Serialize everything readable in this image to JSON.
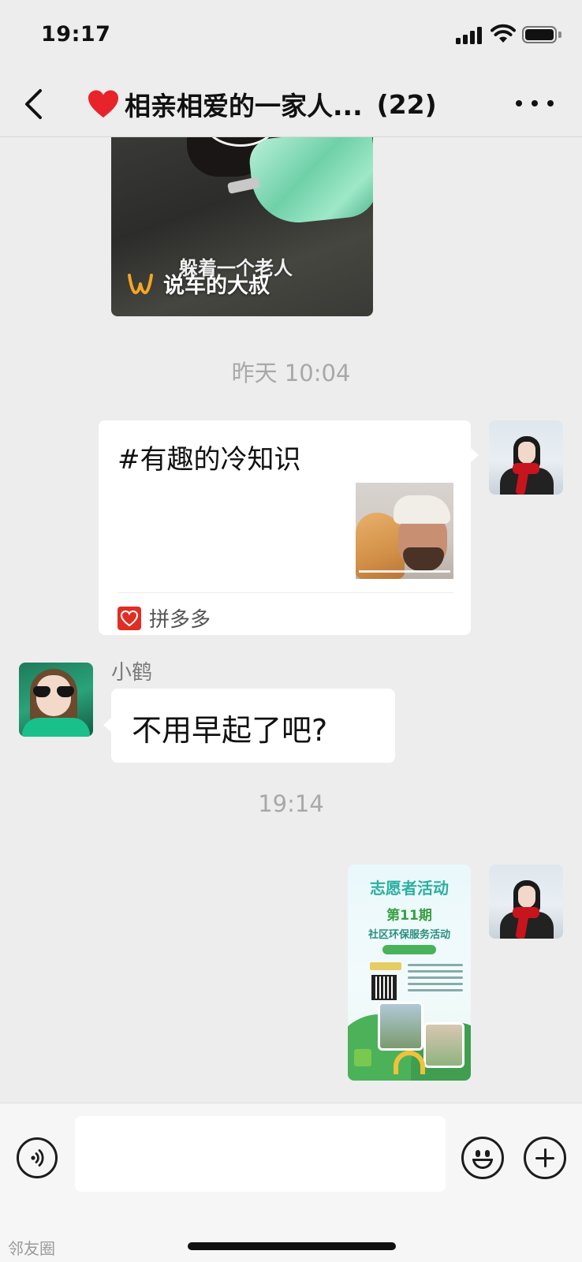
{
  "status_bar": {
    "time": "19:17",
    "icons": [
      "signal-icon",
      "wifi-icon",
      "battery-icon"
    ]
  },
  "nav": {
    "back_icon": "chevron-left-icon",
    "title_emoji": "red-heart-icon",
    "title": "相亲相爱的一家人...",
    "member_count": "(22)",
    "more_icon": "more-dots-icon"
  },
  "messages": {
    "video": {
      "subtitle": "躲着一个老人",
      "channel": "说车的大叔",
      "channel_icon": "channels-logo-icon"
    },
    "timestamp_1": "昨天 10:04",
    "link_card": {
      "title": "#有趣的冷知识",
      "source": "拼多多",
      "source_icon": "pinduoduo-icon"
    },
    "xiaohe": {
      "name": "小鹤",
      "text": "不用早起了吧?"
    },
    "timestamp_2": "19:14",
    "poster": {
      "title": "志愿者活动",
      "issue": "第11期",
      "subtitle": "社区环保服务活动"
    }
  },
  "input_bar": {
    "voice_icon": "voice-icon",
    "emoji_icon": "emoji-icon",
    "plus_icon": "plus-icon",
    "input_value": ""
  },
  "watermark": "邻友圈",
  "colors": {
    "background": "#ededed",
    "bubble": "#ffffff",
    "timestamp": "#a8a8a8",
    "pdd_red": "#e02e24",
    "channels_orange": "#f5a623"
  }
}
